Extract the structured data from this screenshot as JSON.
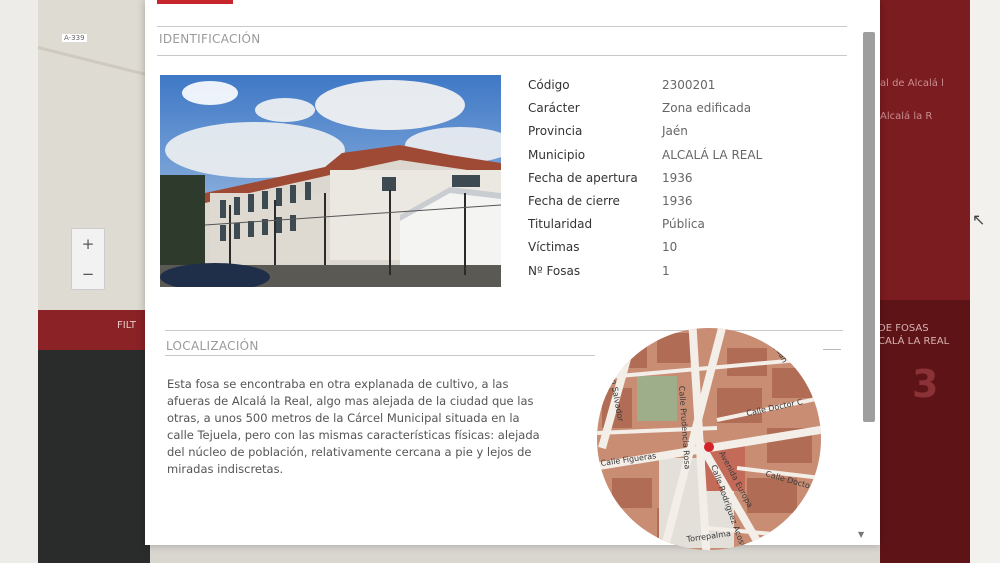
{
  "background": {
    "left_map": {
      "road_badge": "A-339",
      "zoom_in": "+",
      "zoom_out": "−",
      "filter_label": "FILT"
    },
    "right_panel": {
      "item1": "al de Alcalá l",
      "item2": "Alcalá la R",
      "fosas_label_line1": "DE FOSAS",
      "fosas_label_line2": "CALÁ LA REAL",
      "fosas_count": "3"
    },
    "colors": {
      "accent_red": "#c8262d",
      "panel_dark_red": "#7b1c20"
    }
  },
  "modal": {
    "identificacion": {
      "title": "IDENTIFICACIÓN",
      "fields": [
        {
          "label": "Código",
          "value": "2300201"
        },
        {
          "label": "Carácter",
          "value": "Zona edificada"
        },
        {
          "label": "Provincia",
          "value": "Jaén"
        },
        {
          "label": "Municipio",
          "value": "ALCALÁ LA REAL"
        },
        {
          "label": "Fecha de apertura",
          "value": " 1936"
        },
        {
          "label": "Fecha de cierre",
          "value": " 1936"
        },
        {
          "label": "Titularidad",
          "value": "Pública"
        },
        {
          "label": "Víctimas",
          "value": "10"
        },
        {
          "label": "Nº Fosas",
          "value": "1"
        }
      ]
    },
    "localizacion": {
      "title": "LOCALIZACIÓN",
      "description": "Esta fosa se encontraba en otra explanada de cultivo, a las afueras de Alcalá la Real, algo mas alejada de la ciudad que las otras, a unos 500 metros de la Cárcel Municipal situada en la calle Tejuela, pero con las mismas características físicas: alejada del núcleo de población, relativamente cercana a pie y lejos de miradas indiscretas.",
      "map_streets": [
        "Calle Prudencia Rosa",
        "Calle Doctor C",
        "Calle Figueras",
        "Avenida Europa",
        "Calle Doctor",
        "Calle Rodríguez Acosta",
        "Juan",
        "San Salvador",
        "Torrepalma"
      ]
    }
  }
}
